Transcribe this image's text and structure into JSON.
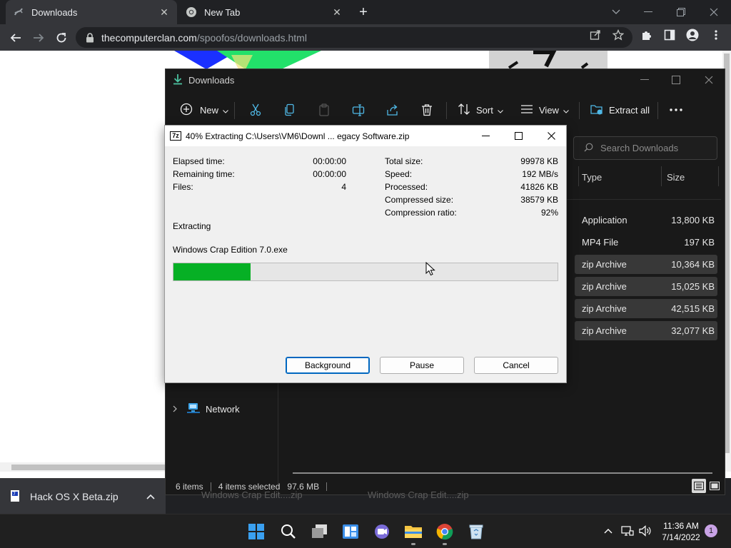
{
  "browser": {
    "tabs": [
      {
        "title": "Downloads",
        "active": true
      },
      {
        "title": "New Tab",
        "active": false
      }
    ],
    "url_host": "thecomputerclan.com",
    "url_path": "/spoofos/downloads.html"
  },
  "download_bar": {
    "filename": "Hack OS X Beta.zip"
  },
  "explorer": {
    "title": "Downloads",
    "commands": {
      "new": "New",
      "sort": "Sort",
      "view": "View",
      "extract_all": "Extract all"
    },
    "search_placeholder": "Search Downloads",
    "columns": {
      "type": "Type",
      "size": "Size"
    },
    "files": [
      {
        "type": "Application",
        "size": "13,800 KB",
        "selected": false
      },
      {
        "type": "MP4 File",
        "size": "197 KB",
        "selected": false
      },
      {
        "type": "zip Archive",
        "size": "10,364 KB",
        "selected": true
      },
      {
        "type": "zip Archive",
        "size": "15,025 KB",
        "selected": true
      },
      {
        "type": "zip Archive",
        "size": "42,515 KB",
        "selected": true
      },
      {
        "type": "zip Archive",
        "size": "32,077 KB",
        "selected": true
      }
    ],
    "nav_network": "Network",
    "status": {
      "items": "6 items",
      "selected": "4 items selected",
      "size": "97.6 MB"
    },
    "ghost_items": [
      "Windows Crap Edit....zip",
      "Windows Crap Edit....zip"
    ]
  },
  "sevenzip": {
    "logo": "7z",
    "title": "40% Extracting C:\\Users\\VM6\\Downl ... egacy Software.zip",
    "left_stats": [
      {
        "label": "Elapsed time:",
        "value": "00:00:00"
      },
      {
        "label": "Remaining time:",
        "value": "00:00:00"
      },
      {
        "label": "Files:",
        "value": "4"
      }
    ],
    "right_stats": [
      {
        "label": "Total size:",
        "value": "99978 KB"
      },
      {
        "label": "Speed:",
        "value": "192 MB/s"
      },
      {
        "label": "Processed:",
        "value": "41826 KB"
      },
      {
        "label": "Compressed size:",
        "value": "38579 KB"
      },
      {
        "label": "Compression ratio:",
        "value": "92%"
      }
    ],
    "status": "Extracting",
    "current_file": "Windows Crap Edition 7.0.exe",
    "progress_fraction": 0.2,
    "buttons": {
      "background": "Background",
      "pause": "Pause",
      "cancel": "Cancel"
    }
  },
  "taskbar": {
    "time": "11:36 AM",
    "date": "7/14/2022",
    "notifications": "1"
  },
  "colors": {
    "progress_fill": "#06b025",
    "accent_blue": "#0067c0"
  }
}
